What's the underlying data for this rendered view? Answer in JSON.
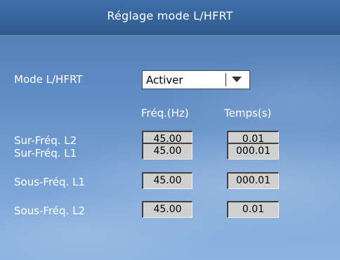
{
  "header": {
    "title": "Réglage mode L/HFRT"
  },
  "mode": {
    "label": "Mode L/HFRT",
    "selected": "Activer"
  },
  "columns": {
    "freq": "Fréq.(Hz)",
    "time": "Temps(s)"
  },
  "rows": [
    {
      "label": "Sur-Fréq. L2",
      "freq": "45.00",
      "time": "0.01"
    },
    {
      "label": "Sur-Fréq. L1",
      "freq": "45.00",
      "time": "000.01"
    },
    {
      "label": "Sous-Fréq. L1",
      "freq": "45.00",
      "time": "000.01"
    },
    {
      "label": "Sous-Fréq. L2",
      "freq": "45.00",
      "time": "0.01"
    }
  ]
}
